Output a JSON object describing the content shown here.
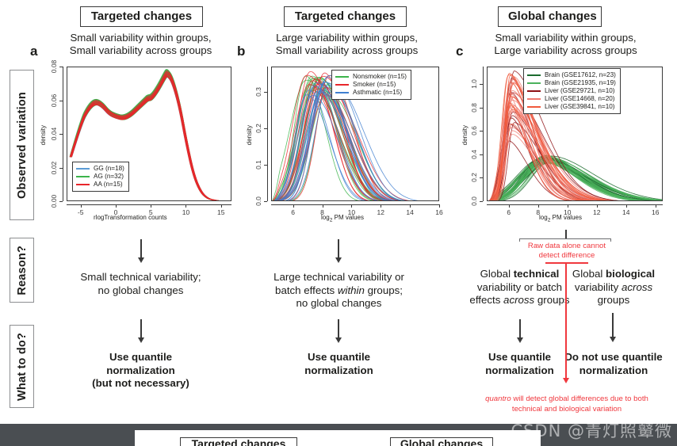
{
  "figure": {
    "rails": [
      {
        "key": "observed",
        "label": "Observed variation"
      },
      {
        "key": "reason",
        "label": "Reason?"
      },
      {
        "key": "whattodo",
        "label": "What to do?"
      }
    ],
    "columns": [
      {
        "letter": "a",
        "title": "Targeted changes",
        "subtitle_line1": "Small variability within groups,",
        "subtitle_line2": "Small variability across groups",
        "reason_line1": "Small technical variability;",
        "reason_line2": "no global changes",
        "action_line1": "Use quantile",
        "action_line2": "normalization",
        "action_line3": "(but not necessary)"
      },
      {
        "letter": "b",
        "title": "Targeted changes",
        "subtitle_line1": "Large variability within groups,",
        "subtitle_line2": "Small variability across groups",
        "reason_line1": "Large technical variability or",
        "reason_line2": "batch effects within groups;",
        "reason_line3": "no global changes",
        "action_line1": "Use quantile",
        "action_line2": "normalization"
      },
      {
        "letter": "c",
        "title": "Global changes",
        "subtitle_line1": "Small variability within groups,",
        "subtitle_line2": "Large variability across groups",
        "reason_left_line1": "Global technical",
        "reason_left_line2": "variability or batch",
        "reason_left_line3": "effects across groups",
        "reason_right_line1": "Global biological",
        "reason_right_line2": "variability across",
        "reason_right_line3": "groups",
        "action_left_line1": "Use quantile",
        "action_left_line2": "normalization",
        "action_right_line1": "Do not use quantile",
        "action_right_line2": "normalization"
      }
    ],
    "red_annotation": {
      "top_line1": "Raw data alone cannot",
      "top_line2": "detect difference",
      "bottom_line1": "quantro will detect global differences due to both",
      "bottom_line2": "technical and biological variation",
      "color": "#f0383e"
    },
    "bottom_strip": {
      "box1_label": "Targeted changes",
      "box2_label": "Global changes"
    },
    "watermark": "CSDN @青灯照鼙微"
  },
  "chart_data": [
    {
      "panel": "a",
      "type": "line",
      "title": "",
      "xlabel": "rlogTransformation counts",
      "ylabel": "density",
      "xlim": [
        -7,
        16.5
      ],
      "ylim": [
        0,
        0.08
      ],
      "xticks": [
        "-5",
        "0",
        "5",
        "10",
        "15"
      ],
      "xtick_values": [
        -5,
        0,
        5,
        10,
        15
      ],
      "yticks": [
        "0.00",
        "0.02",
        "0.04",
        "0.06",
        "0.08"
      ],
      "ytick_values": [
        0.0,
        0.02,
        0.04,
        0.06,
        0.08
      ],
      "grid": false,
      "legend_position": "bottom-left",
      "legend": [
        {
          "label": "GG (n=18)",
          "color": "#5b9bd5",
          "n": 18
        },
        {
          "label": "AG (n=32)",
          "color": "#3cb44b",
          "n": 32
        },
        {
          "label": "AA (n=15)",
          "color": "#e8262b",
          "n": 15
        }
      ],
      "shape_note": "Bimodal overlapping density curves; first mode ~0.060 at x=-3, dip ~0.050 at x=1, shoulder ~0.062 at x=4.5, main mode ~0.077 at x=7.3, decaying to ~0.000 by x=14.",
      "series_profile": {
        "x": [
          -6.5,
          -5,
          -4,
          -3,
          -2,
          -1,
          0,
          1,
          2,
          3,
          4,
          4.5,
          5,
          6,
          7,
          7.3,
          8,
          9,
          10,
          11,
          12,
          13,
          14,
          15,
          16
        ],
        "y": [
          0.027,
          0.048,
          0.056,
          0.06,
          0.058,
          0.053,
          0.051,
          0.05,
          0.052,
          0.056,
          0.06,
          0.062,
          0.062,
          0.068,
          0.076,
          0.077,
          0.073,
          0.058,
          0.035,
          0.016,
          0.006,
          0.002,
          0.001,
          0.0005,
          0.0004
        ]
      }
    },
    {
      "panel": "b",
      "type": "line",
      "title": "",
      "xlabel": "log2 PM values",
      "ylabel": "density",
      "xlim": [
        4.5,
        16
      ],
      "ylim": [
        0,
        0.37
      ],
      "xticks": [
        "6",
        "8",
        "10",
        "12",
        "14",
        "16"
      ],
      "xtick_values": [
        6,
        8,
        10,
        12,
        14,
        16
      ],
      "yticks": [
        "0.0",
        "0.1",
        "0.2",
        "0.3"
      ],
      "ytick_values": [
        0.0,
        0.1,
        0.2,
        0.3
      ],
      "grid": false,
      "legend_position": "top-right",
      "legend": [
        {
          "label": "Nonsmoker (n=15)",
          "color": "#3cb44b",
          "n": 15
        },
        {
          "label": "Smoker (n=15)",
          "color": "#e8262b",
          "n": 15
        },
        {
          "label": "Asthmatic (n=15)",
          "color": "#3f7fd0",
          "n": 15
        }
      ],
      "shape_note": "Many unimodal right-skewed density curves, peaks scattered between x=6.8 and x=8.4 with heights 0.29-0.36, long right tail to x=16.",
      "peak_range_x": [
        6.8,
        8.4
      ],
      "peak_range_y": [
        0.29,
        0.36
      ]
    },
    {
      "panel": "c",
      "type": "line",
      "title": "",
      "xlabel": "log2 PM values",
      "ylabel": "density",
      "xlim": [
        4.5,
        16.5
      ],
      "ylim": [
        0,
        1.15
      ],
      "xticks": [
        "6",
        "8",
        "10",
        "12",
        "14",
        "16"
      ],
      "xtick_values": [
        6,
        8,
        10,
        12,
        14,
        16
      ],
      "yticks": [
        "0.0",
        "0.2",
        "0.4",
        "0.6",
        "0.8",
        "1.0"
      ],
      "ytick_values": [
        0.0,
        0.2,
        0.4,
        0.6,
        0.8,
        1.0
      ],
      "grid": false,
      "legend_position": "top-right",
      "legend": [
        {
          "label": "Brain (GSE17612, n=23)",
          "color": "#1b6b2e",
          "n": 23
        },
        {
          "label": "Brain (GSE21935, n=19)",
          "color": "#4bb25c",
          "n": 19
        },
        {
          "label": "Liver (GSE29721, n=10)",
          "color": "#8e1014",
          "n": 10
        },
        {
          "label": "Liver (GSE14668, n=20)",
          "color": "#f07a70",
          "n": 20
        },
        {
          "label": "Liver (GSE39841, n=10)",
          "color": "#f0593c",
          "n": 10
        }
      ],
      "shape_note": "Two clusters: red/orange Liver curves peak sharply near x=6.1 with heights 0.5-1.13; green Brain curves peak broadly near x=8.2-8.6 with heights ~0.33-0.40 and long right tail.",
      "liver_peak_x": 6.1,
      "liver_peak_y_range": [
        0.5,
        1.13
      ],
      "brain_peak_x_range": [
        8.0,
        8.8
      ],
      "brain_peak_y_range": [
        0.33,
        0.4
      ]
    }
  ]
}
